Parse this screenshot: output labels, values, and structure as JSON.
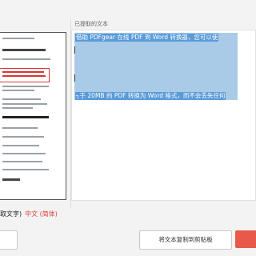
{
  "right_panel": {
    "title": "已提取的文本",
    "lines": [
      "借助 PDFgear 在线 PDF 到 Word 转换器，您可以使",
      "┐于 20MB 的 PDF 转换为 Word 格式，而不会丢失任何"
    ]
  },
  "bottom": {
    "label": "取文字)",
    "language": "中文 (简体)"
  },
  "buttons": {
    "copy_label": "将文本复制到剪贴板"
  },
  "colors": {
    "accent_red": "#e8594b",
    "selection": "#a9cbe8",
    "selection_text_bg": "#5a9bd8"
  }
}
